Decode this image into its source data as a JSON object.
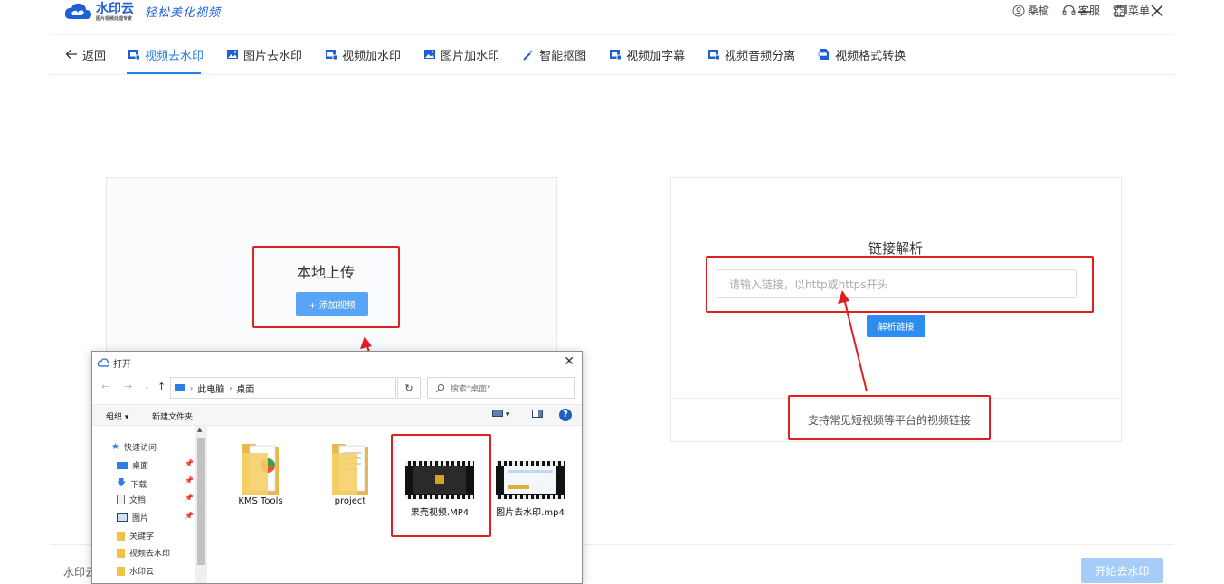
{
  "app": {
    "logo_text": "水印云",
    "logo_sub": "图片视频处理专家",
    "slogan": "轻松美化视频"
  },
  "topbar": {
    "user": "桑榆",
    "service": "客服",
    "menu": "菜单"
  },
  "toolbar": {
    "back": "返回",
    "tabs": [
      "视频去水印",
      "图片去水印",
      "视频加水印",
      "图片加水印",
      "智能抠图",
      "视频加字幕",
      "视频音频分离",
      "视频格式转换"
    ],
    "active_index": 0
  },
  "local_upload": {
    "title": "本地上传",
    "button": "+ 添加视频"
  },
  "link_parse": {
    "title": "链接解析",
    "placeholder": "请输入链接，以http或https开头",
    "button": "解析链接",
    "support_text": "支持常见短视频等平台的视频链接"
  },
  "footer": {
    "left_text": "水印云",
    "start_button": "开始去水印"
  },
  "dialog": {
    "title": "打开",
    "path": [
      "此电脑",
      "桌面"
    ],
    "search_placeholder": "搜索\"桌面\"",
    "organize": "组织 ▾",
    "new_folder": "新建文件夹",
    "nav_items": [
      {
        "label": "快速访问",
        "icon": "star-icon"
      },
      {
        "label": "桌面",
        "icon": "desktop-icon",
        "pinned": true
      },
      {
        "label": "下载",
        "icon": "download-icon",
        "pinned": true
      },
      {
        "label": "文档",
        "icon": "document-icon",
        "pinned": true
      },
      {
        "label": "图片",
        "icon": "picture-icon",
        "pinned": true
      },
      {
        "label": "关键字",
        "icon": "folder-icon"
      },
      {
        "label": "视频去水印",
        "icon": "folder-icon"
      },
      {
        "label": "水印云",
        "icon": "folder-icon"
      }
    ],
    "files": [
      {
        "name": "KMS Tools",
        "type": "folder"
      },
      {
        "name": "project",
        "type": "folder"
      },
      {
        "name": "果壳视频.MP4",
        "type": "video"
      },
      {
        "name": "图片去水印.mp4",
        "type": "video"
      }
    ]
  },
  "colors": {
    "accent": "#2b7fe6",
    "annotation_red": "#e02020",
    "button_blue": "#2d8cf0"
  }
}
